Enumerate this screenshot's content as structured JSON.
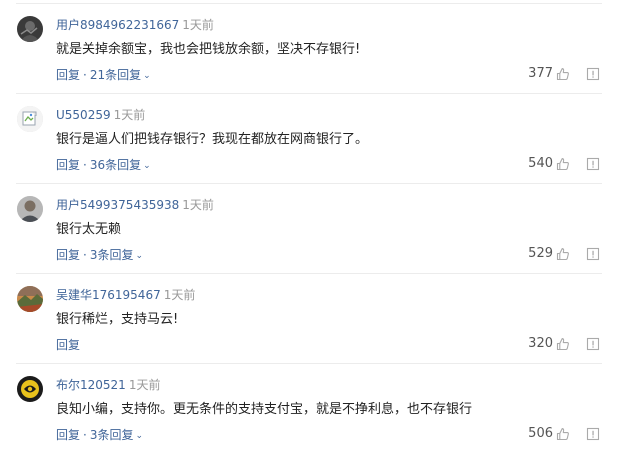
{
  "comments": [
    {
      "username": "用户8984962231667",
      "time": "1天前",
      "text": "就是关掉余额宝，我也会把钱放余额，坚决不存银行!",
      "reply_label": "回复",
      "replies_label": "21条回复",
      "likes": "377",
      "avatar": "dark-photo"
    },
    {
      "username": "U550259",
      "time": "1天前",
      "text": "银行是逼人们把钱存银行？我现在都放在网商银行了。",
      "reply_label": "回复",
      "replies_label": "36条回复",
      "likes": "540",
      "avatar": "broken-image"
    },
    {
      "username": "用户5499375435938",
      "time": "1天前",
      "text": "银行太无赖",
      "reply_label": "回复",
      "replies_label": "3条回复",
      "likes": "529",
      "avatar": "person-photo"
    },
    {
      "username": "吴建华176195467",
      "time": "1天前",
      "text": "银行稀烂，支持马云!",
      "reply_label": "回复",
      "replies_label": "",
      "likes": "320",
      "avatar": "landscape-photo"
    },
    {
      "username": "布尔120521",
      "time": "1天前",
      "text": "良知小编，支持你。更无条件的支持支付宝，就是不挣利息，也不存银行",
      "reply_label": "回复",
      "replies_label": "3条回复",
      "likes": "506",
      "avatar": "yellow-logo"
    }
  ],
  "icons": {
    "like": "thumbs-up-icon",
    "report": "report-icon",
    "expand": "chevron-down-icon"
  },
  "colors": {
    "link": "#406599",
    "time": "#999999",
    "text": "#222222",
    "icon": "#aaaaaa"
  }
}
